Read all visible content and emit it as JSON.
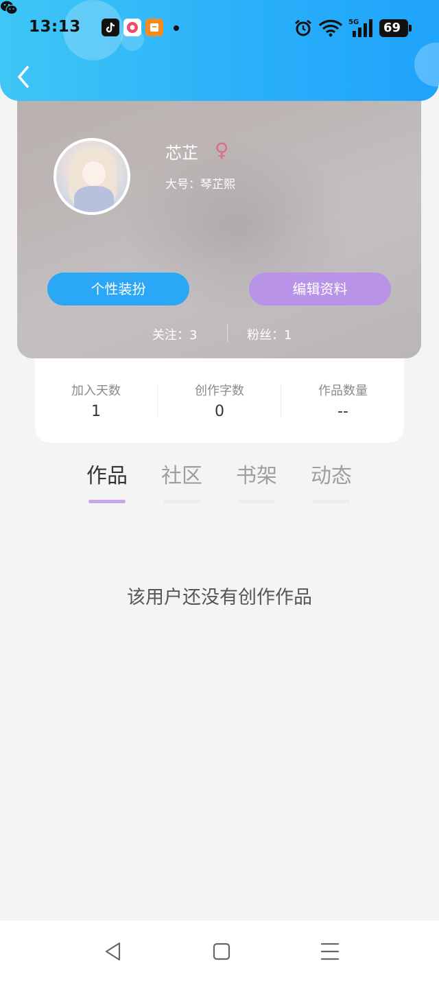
{
  "status_bar": {
    "time": "13:13",
    "battery": "69",
    "notification_icons": [
      "wechat-icon",
      "tiktok-icon",
      "app-icon",
      "reader-app-icon"
    ],
    "system_icons": [
      "alarm-icon",
      "wifi-icon",
      "5g-signal-icon",
      "battery-icon"
    ],
    "network": "5G"
  },
  "header": {
    "back_icon": "chevron-left-icon",
    "color_start": "#3fc6f6",
    "color_end": "#1fa3fb"
  },
  "profile": {
    "name": "芯芷",
    "gender_symbol": "♀",
    "alias": "大号：琴芷熙",
    "buttons": {
      "dress_up": "个性装扮",
      "edit_profile": "编辑资料"
    },
    "following": "关注：3",
    "followers": "粉丝：1"
  },
  "stats": [
    {
      "label": "加入天数",
      "value": "1"
    },
    {
      "label": "创作字数",
      "value": "0"
    },
    {
      "label": "作品数量",
      "value": "--"
    }
  ],
  "tabs": [
    {
      "label": "作品",
      "active": true
    },
    {
      "label": "社区",
      "active": false
    },
    {
      "label": "书架",
      "active": false
    },
    {
      "label": "动态",
      "active": false
    }
  ],
  "empty_state": "该用户还没有创作作品",
  "nav_bar": {
    "icons": [
      "back-triangle-icon",
      "home-square-icon",
      "menu-lines-icon"
    ]
  },
  "colors": {
    "accent_blue": "#2aa8f5",
    "accent_purple": "#b993e8",
    "tab_indicator": "#c7a6ea",
    "gender_pink": "#e06b86"
  }
}
